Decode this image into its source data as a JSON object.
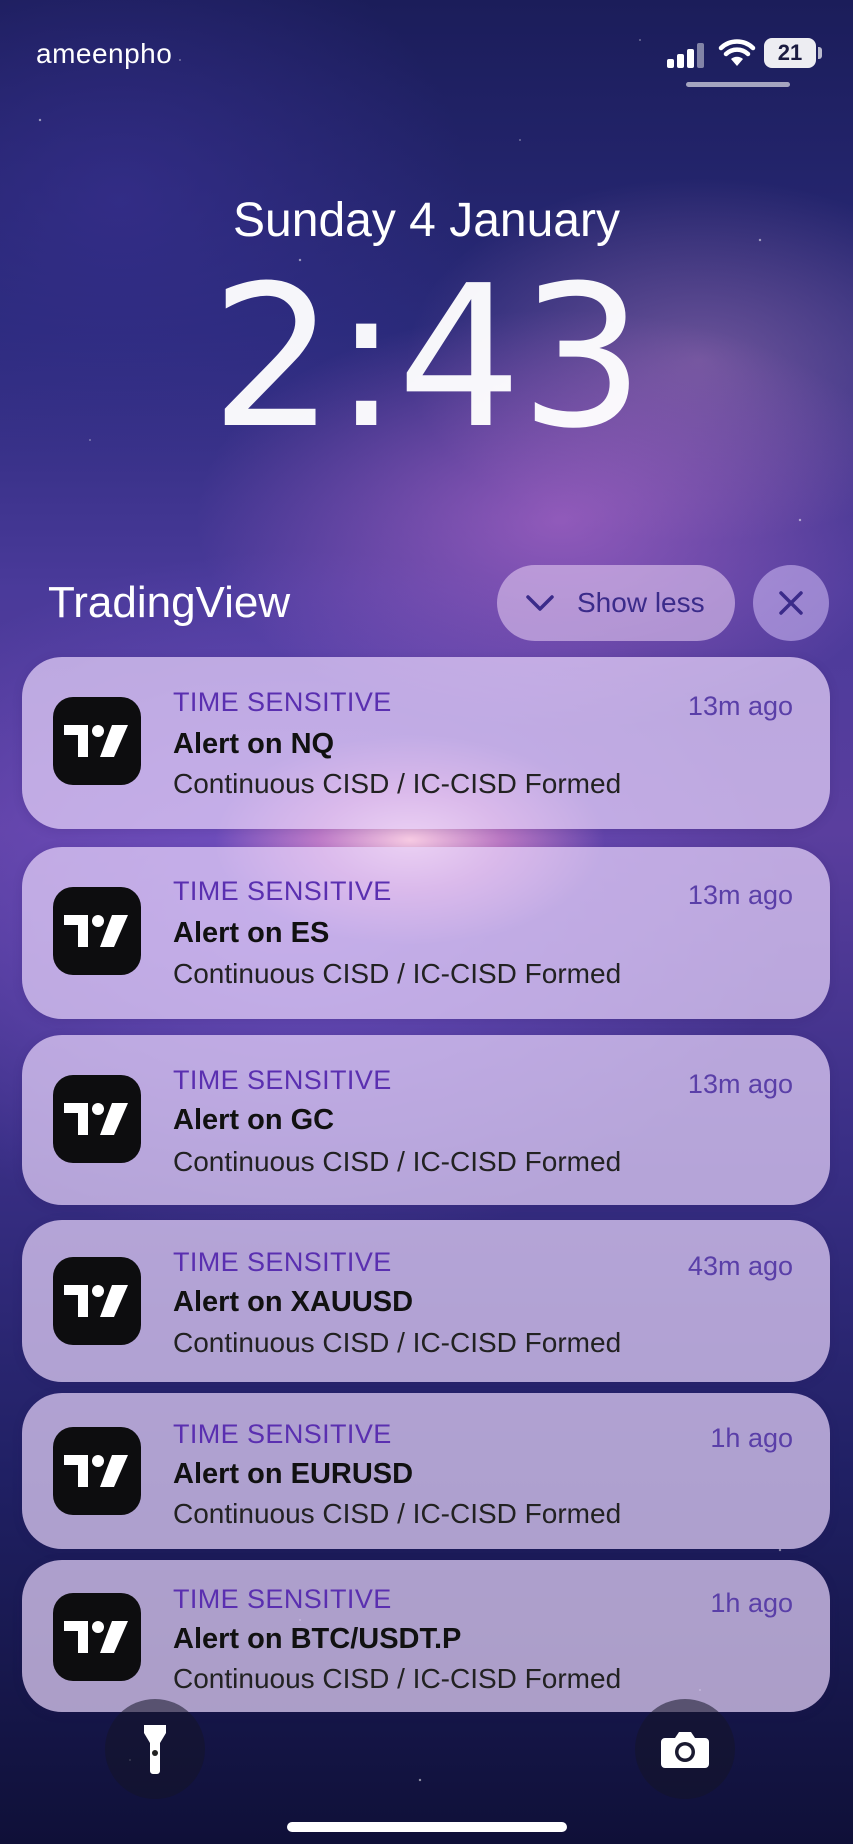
{
  "status_bar": {
    "carrier": "ameenpho",
    "battery": "21"
  },
  "lock_screen": {
    "date": "Sunday 4 January",
    "time": "2:43"
  },
  "group": {
    "app_name": "TradingView",
    "show_less_label": "Show less"
  },
  "notifications": [
    {
      "tag": "TIME SENSITIVE",
      "ago": "13m ago",
      "title": "Alert on NQ",
      "body": "Continuous CISD / IC-CISD Formed"
    },
    {
      "tag": "TIME SENSITIVE",
      "ago": "13m ago",
      "title": "Alert on ES",
      "body": "Continuous CISD / IC-CISD Formed"
    },
    {
      "tag": "TIME SENSITIVE",
      "ago": "13m ago",
      "title": "Alert on GC",
      "body": "Continuous CISD / IC-CISD Formed"
    },
    {
      "tag": "TIME SENSITIVE",
      "ago": "43m ago",
      "title": "Alert on XAUUSD",
      "body": "Continuous CISD / IC-CISD Formed"
    },
    {
      "tag": "TIME SENSITIVE",
      "ago": "1h ago",
      "title": "Alert on EURUSD",
      "body": "Continuous CISD / IC-CISD Formed"
    },
    {
      "tag": "TIME SENSITIVE",
      "ago": "1h ago",
      "title": "Alert on BTC/USDT.P",
      "body": "Continuous CISD / IC-CISD Formed"
    }
  ],
  "icons": {
    "app_icon": "tradingview-logo-icon",
    "show_less": "chevron-down-icon",
    "close": "close-icon",
    "flashlight": "flashlight-icon",
    "camera": "camera-icon",
    "signal": "cellular-signal-icon",
    "wifi": "wifi-icon",
    "battery": "battery-icon"
  },
  "colors": {
    "tag": "#5a2fb0",
    "notification_bg": "rgba(230,210,250,0.72)"
  }
}
